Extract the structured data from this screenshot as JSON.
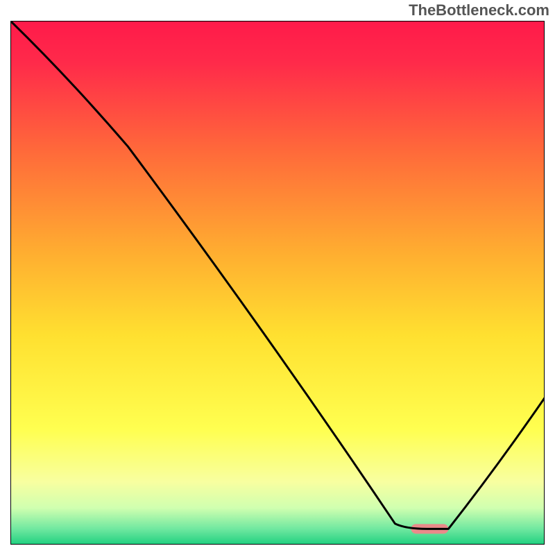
{
  "watermark": "TheBottleneck.com",
  "chart_data": {
    "type": "line",
    "title": "",
    "xlabel": "",
    "ylabel": "",
    "xlim": [
      0,
      100
    ],
    "ylim": [
      0,
      100
    ],
    "grid": false,
    "legend": false,
    "background": {
      "type": "vertical-gradient",
      "stops": [
        {
          "pos": 0.0,
          "color": "#ff1a4a"
        },
        {
          "pos": 0.08,
          "color": "#ff2a4a"
        },
        {
          "pos": 0.25,
          "color": "#ff6a3a"
        },
        {
          "pos": 0.45,
          "color": "#ffb030"
        },
        {
          "pos": 0.6,
          "color": "#ffe030"
        },
        {
          "pos": 0.78,
          "color": "#ffff50"
        },
        {
          "pos": 0.88,
          "color": "#f8ffa0"
        },
        {
          "pos": 0.93,
          "color": "#d0ffb0"
        },
        {
          "pos": 0.97,
          "color": "#70e8a0"
        },
        {
          "pos": 1.0,
          "color": "#20d080"
        }
      ]
    },
    "series": [
      {
        "name": "curve",
        "color": "#000000",
        "points": [
          {
            "x": 0,
            "y": 100
          },
          {
            "x": 22,
            "y": 76
          },
          {
            "x": 72,
            "y": 4
          },
          {
            "x": 74,
            "y": 3
          },
          {
            "x": 82,
            "y": 3
          },
          {
            "x": 100,
            "y": 28
          }
        ]
      }
    ],
    "marker": {
      "x_start": 75,
      "x_end": 82,
      "y": 3,
      "color": "#e98a8a"
    }
  }
}
